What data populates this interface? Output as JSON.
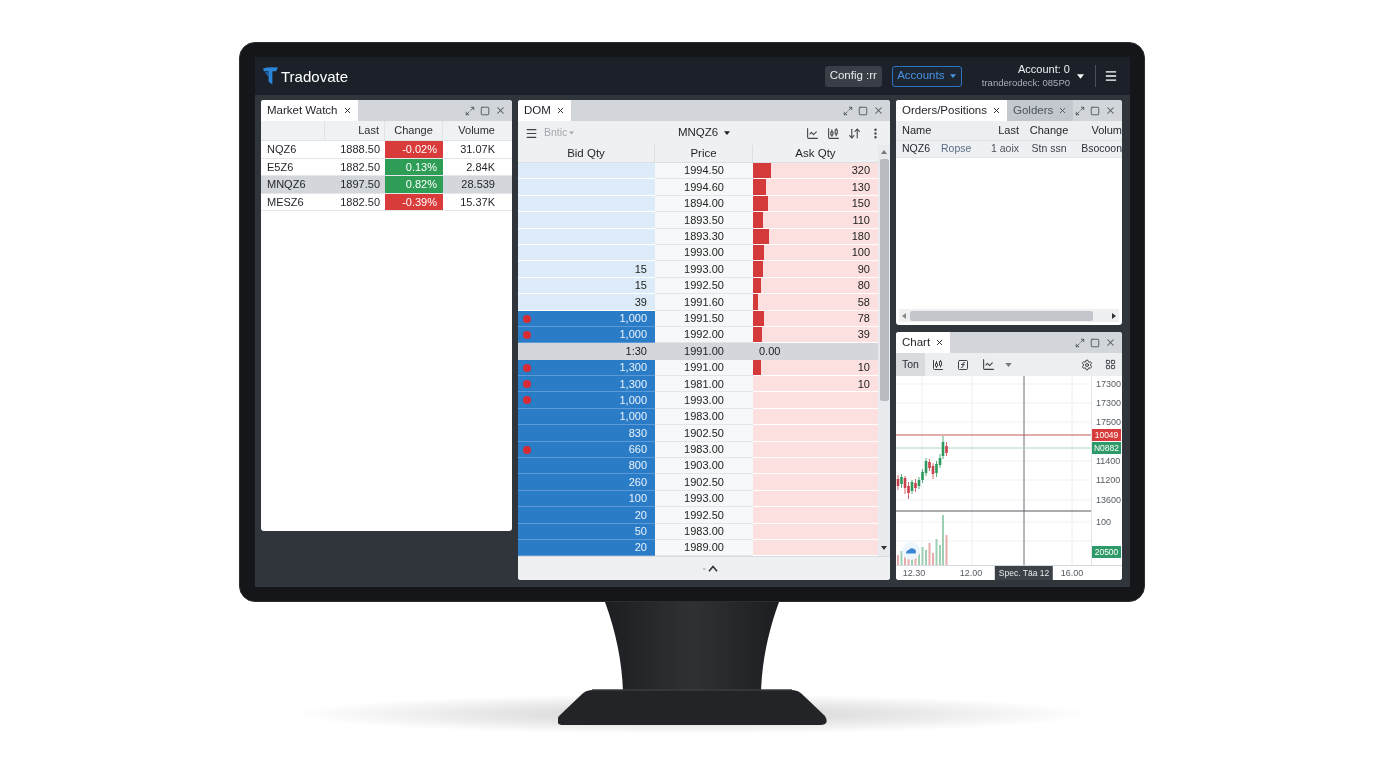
{
  "header": {
    "logo_text": "Tradovate",
    "buttons": [
      {
        "label": "Config :rr",
        "kind": "plain"
      },
      {
        "label": "Accounts",
        "kind": "dropdown"
      }
    ],
    "account": {
      "title": "Account: 0",
      "subtitle": "tranderodeck: 085P0"
    }
  },
  "market_watch": {
    "tabs": [
      {
        "label": "Market Watch",
        "selected": true
      }
    ],
    "columns": [
      "Last",
      "Change",
      "Volume"
    ],
    "rows": [
      {
        "symbol": "NQZ6",
        "last": "1888.50",
        "change": "-0.02%",
        "color": "#d93a3a",
        "volume": "31.07K",
        "selected": false
      },
      {
        "symbol": "E5Z6",
        "last": "1882.50",
        "change": "0.13%",
        "color": "#2e9d55",
        "volume": "2.84K",
        "selected": false
      },
      {
        "symbol": "MNQZ6",
        "last": "1897.50",
        "change": "0.82%",
        "color": "#2e9d55",
        "volume": "28.539",
        "selected": true
      },
      {
        "symbol": "MESZ6",
        "last": "1882.50",
        "change": "-0.39%",
        "color": "#d93a3a",
        "volume": "15.37K",
        "selected": false
      }
    ]
  },
  "dom": {
    "tabs": [
      {
        "label": "DOM",
        "selected": true
      }
    ],
    "mode": "Bntic",
    "symbol": "MNQZ6",
    "columns": [
      "Bid Qty",
      "Price",
      "Ask Qty"
    ],
    "rows": [
      {
        "kind": "level",
        "price": "1994.50",
        "ask": "320",
        "level": 0.14,
        "bid_highlight": false,
        "order_marker": false
      },
      {
        "kind": "level",
        "price": "1994.60",
        "ask": "130",
        "level": 0.1,
        "bid_highlight": false,
        "order_marker": false
      },
      {
        "kind": "level",
        "price": "1894.00",
        "ask": "150",
        "level": 0.12,
        "bid_highlight": false,
        "order_marker": false
      },
      {
        "kind": "level",
        "price": "1893.50",
        "ask": "110",
        "level": 0.08,
        "bid_highlight": false,
        "order_marker": false
      },
      {
        "kind": "level",
        "price": "1893.30",
        "ask": "180",
        "level": 0.13,
        "bid_highlight": false,
        "order_marker": false
      },
      {
        "kind": "level",
        "price": "1993.00",
        "ask": "100",
        "level": 0.09,
        "bid_highlight": false,
        "order_marker": false
      },
      {
        "kind": "level",
        "bid": "15",
        "price": "1993.00",
        "ask": "90",
        "level": 0.08,
        "bid_highlight": false,
        "order_marker": false
      },
      {
        "kind": "level",
        "bid": "15",
        "price": "1992.50",
        "ask": "80",
        "level": 0.06,
        "bid_highlight": false,
        "order_marker": false
      },
      {
        "kind": "level",
        "bid": "39",
        "price": "1991.60",
        "ask": "58",
        "level": 0.04,
        "bid_highlight": false,
        "order_marker": false
      },
      {
        "kind": "level",
        "bid": "1,000",
        "price": "1991.50",
        "ask": "78",
        "level": 0.09,
        "bid_highlight": true,
        "order_marker": true
      },
      {
        "kind": "level",
        "bid": "1,000",
        "price": "1992.00",
        "ask": "39",
        "level": 0.07,
        "bid_highlight": true,
        "order_marker": true
      },
      {
        "kind": "market",
        "bid": "1:30",
        "price": "1991.00",
        "ask": "0.00"
      },
      {
        "kind": "level",
        "bid": "1,300",
        "price": "1991.00",
        "ask": "10",
        "level": 0.06,
        "bid_highlight": true,
        "order_marker": true
      },
      {
        "kind": "level",
        "bid": "1,300",
        "price": "1981.00",
        "ask": "10",
        "bid_highlight": true,
        "order_marker": true
      },
      {
        "kind": "level",
        "bid": "1,000",
        "price": "1993.00",
        "bid_highlight": true,
        "order_marker": true
      },
      {
        "kind": "level",
        "bid": "1,000",
        "price": "1983.00",
        "bid_highlight": true,
        "order_marker": false
      },
      {
        "kind": "level",
        "bid": "830",
        "price": "1902.50",
        "bid_highlight": true,
        "order_marker": false
      },
      {
        "kind": "level",
        "bid": "660",
        "price": "1983.00",
        "bid_highlight": true,
        "order_marker": true
      },
      {
        "kind": "level",
        "bid": "800",
        "price": "1903.00",
        "bid_highlight": true,
        "order_marker": false
      },
      {
        "kind": "level",
        "bid": "260",
        "price": "1902.50",
        "bid_highlight": true,
        "order_marker": false
      },
      {
        "kind": "level",
        "bid": "100",
        "price": "1993.00",
        "bid_highlight": true,
        "order_marker": false
      },
      {
        "kind": "level",
        "bid": "20",
        "price": "1992.50",
        "bid_highlight": true,
        "order_marker": false
      },
      {
        "kind": "level",
        "bid": "50",
        "price": "1983.00",
        "bid_highlight": true,
        "order_marker": false
      },
      {
        "kind": "level",
        "bid": "20",
        "price": "1989.00",
        "bid_highlight": true,
        "order_marker": false
      }
    ]
  },
  "orders": {
    "tabs": [
      {
        "label": "Orders/Positions",
        "selected": true
      },
      {
        "label": "Golders",
        "selected": false
      }
    ],
    "columns": [
      "Name",
      "",
      "Last",
      "Change",
      "Volum"
    ],
    "rows": [
      {
        "cells": [
          "NQZ6",
          "Ropse",
          "1 aoix",
          "Stn ssn",
          "Bsocoon"
        ]
      }
    ]
  },
  "chart": {
    "tabs": [
      {
        "label": "Chart",
        "selected": true
      }
    ],
    "interval": "Ton",
    "price_labels": [
      {
        "text": "17300",
        "kind": "label"
      },
      {
        "text": "17300",
        "kind": "label"
      },
      {
        "text": "17500",
        "kind": "label"
      },
      {
        "text": "10049",
        "kind": "badge",
        "color": "#d83b3b"
      },
      {
        "text": "N0882",
        "kind": "badge",
        "color": "#2e9a6a"
      },
      {
        "text": "11400",
        "kind": "label"
      },
      {
        "text": "11200",
        "kind": "label"
      },
      {
        "text": "13600",
        "kind": "label"
      },
      {
        "text": "100",
        "kind": "label"
      },
      {
        "text": "20500",
        "kind": "badge",
        "color": "#2e9a6a"
      }
    ],
    "time_labels": [
      {
        "text": "12.30",
        "kind": "label"
      },
      {
        "text": "12.00",
        "kind": "label"
      },
      {
        "text": "Spec. Täa 12",
        "kind": "badge",
        "color": "#3d4248"
      },
      {
        "text": "16.00",
        "kind": "label"
      }
    ]
  }
}
